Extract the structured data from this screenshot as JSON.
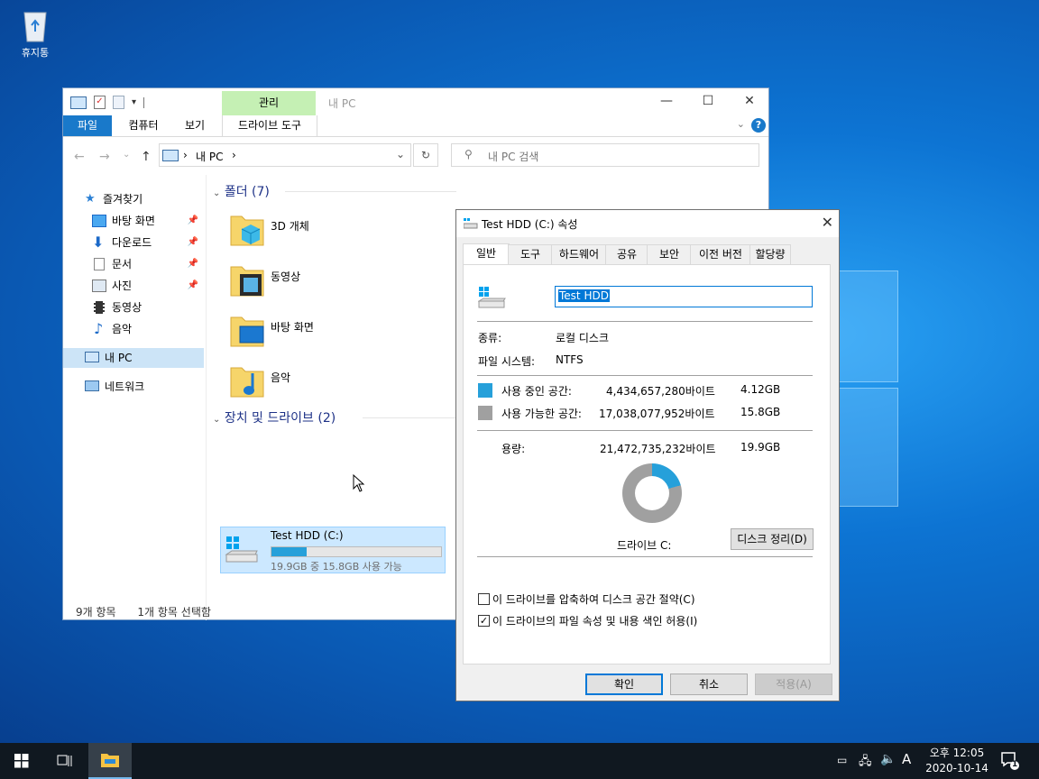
{
  "desktop": {
    "recycle_bin_label": "휴지통"
  },
  "explorer": {
    "title": "내 PC",
    "context_tab_header": "관리",
    "ribbon_tabs": [
      "파일",
      "컴퓨터",
      "보기",
      "드라이브 도구"
    ],
    "address": {
      "crumb": "내 PC",
      "sep1": "›",
      "sep2": "›"
    },
    "search_placeholder": "내 PC 검색",
    "sidebar": {
      "quick_access": "즐겨찾기",
      "items": [
        {
          "label": "바탕 화면",
          "pinned": true,
          "icon": "desktop-icon"
        },
        {
          "label": "다운로드",
          "pinned": true,
          "icon": "download-icon"
        },
        {
          "label": "문서",
          "pinned": true,
          "icon": "document-icon"
        },
        {
          "label": "사진",
          "pinned": true,
          "icon": "picture-icon"
        },
        {
          "label": "동영상",
          "pinned": false,
          "icon": "video-icon"
        },
        {
          "label": "음악",
          "pinned": false,
          "icon": "music-icon"
        }
      ],
      "this_pc": "내 PC",
      "network": "네트워크"
    },
    "folders_group": "폴더 (7)",
    "folders": [
      "3D 개체",
      "동영상",
      "바탕 화면",
      "음악"
    ],
    "drives_group": "장치 및 드라이브 (2)",
    "drive": {
      "name": "Test HDD (C:)",
      "free_text": "19.9GB 중 15.8GB 사용 가능",
      "used_fraction": 0.207
    },
    "status": {
      "item_count": "9개 항목",
      "selected": "1개 항목 선택함"
    }
  },
  "dialog": {
    "title": "Test HDD (C:) 속성",
    "tabs": [
      "일반",
      "도구",
      "하드웨어",
      "공유",
      "보안",
      "이전 버전",
      "할당량"
    ],
    "name_value": "Test HDD",
    "type_label": "종류:",
    "type_value": "로컬 디스크",
    "fs_label": "파일 시스템:",
    "fs_value": "NTFS",
    "used_label": "사용 중인 공간:",
    "used_bytes": "4,434,657,280바이트",
    "used_gb": "4.12GB",
    "free_label": "사용 가능한 공간:",
    "free_bytes": "17,038,077,952바이트",
    "free_gb": "15.8GB",
    "capacity_label": "용량:",
    "capacity_bytes": "21,472,735,232바이트",
    "capacity_gb": "19.9GB",
    "drive_label": "드라이브 C:",
    "cleanup_button": "디스크 정리(D)",
    "compress_label": "이 드라이브를 압축하여 디스크 공간 절약(C)",
    "compress_checked": false,
    "index_label": "이 드라이브의 파일 속성 및 내용 색인 허용(I)",
    "index_checked": true,
    "ok_button": "확인",
    "cancel_button": "취소",
    "apply_button": "적용(A)",
    "colors": {
      "used": "#26a0da",
      "free": "#a0a0a0"
    }
  },
  "taskbar": {
    "time": "오후 12:05",
    "date": "2020-10-14",
    "ime": "A",
    "notification_count": "1"
  }
}
